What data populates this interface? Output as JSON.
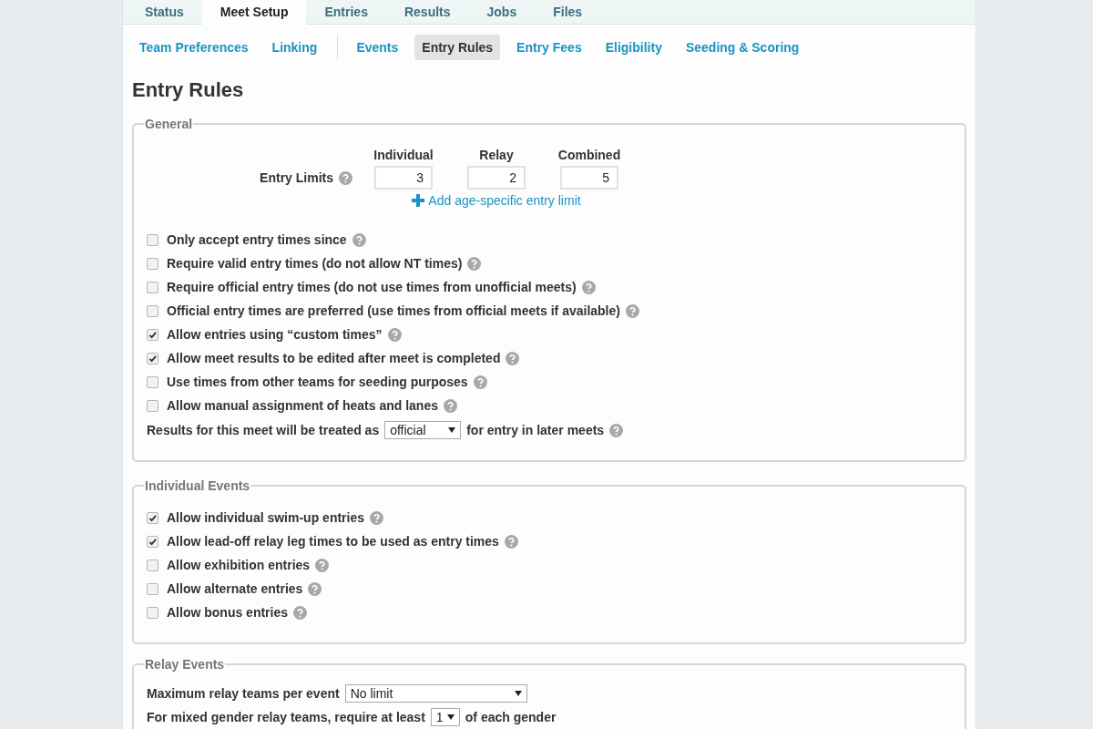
{
  "tabs": [
    {
      "label": "Status",
      "selected": false
    },
    {
      "label": "Meet Setup",
      "selected": true
    },
    {
      "label": "Entries",
      "selected": false
    },
    {
      "label": "Results",
      "selected": false
    },
    {
      "label": "Jobs",
      "selected": false
    },
    {
      "label": "Files",
      "selected": false
    }
  ],
  "subtab_groups": [
    [
      {
        "label": "Team Preferences",
        "selected": false
      },
      {
        "label": "Linking",
        "selected": false
      }
    ],
    [
      {
        "label": "Events",
        "selected": false
      },
      {
        "label": "Entry Rules",
        "selected": true
      },
      {
        "label": "Entry Fees",
        "selected": false
      },
      {
        "label": "Eligibility",
        "selected": false
      },
      {
        "label": "Seeding & Scoring",
        "selected": false
      }
    ]
  ],
  "heading": "Entry Rules",
  "general": {
    "legend": "General",
    "entry_limits": {
      "label": "Entry Limits",
      "columns": [
        {
          "header": "Individual",
          "value": "3"
        },
        {
          "header": "Relay",
          "value": "2"
        },
        {
          "header": "Combined",
          "value": "5"
        }
      ],
      "add_link": "Add age-specific entry limit"
    },
    "options": [
      {
        "label": "Only accept entry times since",
        "checked": false
      },
      {
        "label": "Require valid entry times (do not allow NT times)",
        "checked": false
      },
      {
        "label": "Require official entry times (do not use times from unofficial meets)",
        "checked": false
      },
      {
        "label": "Official entry times are preferred (use times from official meets if available)",
        "checked": false
      },
      {
        "label": "Allow entries using “custom times”",
        "checked": true
      },
      {
        "label": "Allow meet results to be edited after meet is completed",
        "checked": true
      },
      {
        "label": "Use times from other teams for seeding purposes",
        "checked": false
      },
      {
        "label": "Allow manual assignment of heats and lanes",
        "checked": false
      }
    ],
    "results_treatment": {
      "before": "Results for this meet will be treated as",
      "value": "official",
      "after": "for entry in later meets"
    }
  },
  "individual": {
    "legend": "Individual Events",
    "options": [
      {
        "label": "Allow individual swim-up entries",
        "checked": true
      },
      {
        "label": "Allow lead-off relay leg times to be used as entry times",
        "checked": true
      },
      {
        "label": "Allow exhibition entries",
        "checked": false
      },
      {
        "label": "Allow alternate entries",
        "checked": false
      },
      {
        "label": "Allow bonus entries",
        "checked": false
      }
    ]
  },
  "relay": {
    "legend": "Relay Events",
    "max_teams": {
      "label": "Maximum relay teams per event",
      "value": "No limit"
    },
    "mixed": {
      "before": "For mixed gender relay teams, require at least",
      "value": "1",
      "after": "of each gender"
    }
  }
}
